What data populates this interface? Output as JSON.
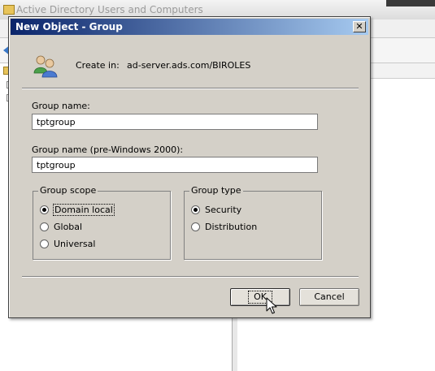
{
  "background_window": {
    "title": "Active Directory Users and Computers"
  },
  "dialog": {
    "title": "New Object - Group",
    "close_glyph": "✕",
    "create_in_label": "Create in:",
    "create_in_path": "ad-server.ads.com/BIROLES",
    "group_name_label": "Group name:",
    "group_name_value": "tptgroup",
    "group_name_pre2000_label": "Group name (pre-Windows 2000):",
    "group_name_pre2000_value": "tptgroup",
    "group_scope": {
      "legend": "Group scope",
      "options": [
        "Domain local",
        "Global",
        "Universal"
      ],
      "selected": "Domain local"
    },
    "group_type": {
      "legend": "Group type",
      "options": [
        "Security",
        "Distribution"
      ],
      "selected": "Security"
    },
    "ok_label": "OK",
    "cancel_label": "Cancel"
  },
  "icons": [
    "group-users-icon",
    "close-icon",
    "mouse-pointer-icon",
    "back-arrow-icon",
    "folder-icon"
  ],
  "colors": {
    "titlebar_start": "#0a246a",
    "titlebar_end": "#a6caf0",
    "dialog_face": "#d4d0c8"
  }
}
